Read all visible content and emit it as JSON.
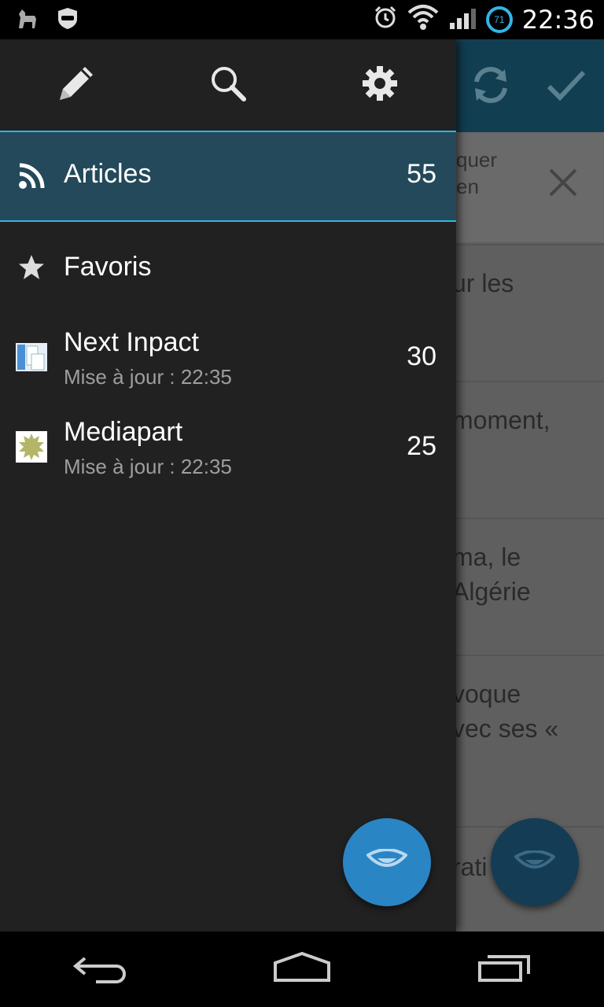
{
  "status_bar": {
    "time": "22:36",
    "battery_level": "71"
  },
  "background": {
    "banner": {
      "line1": "quer",
      "line2": "en"
    },
    "rows": [
      {
        "line1": "ur les",
        "line2": ""
      },
      {
        "line1": "moment,",
        "line2": ""
      },
      {
        "line1": "ma, le",
        "line2": "Algérie"
      },
      {
        "line1": "voque",
        "line2": "vec ses «"
      },
      {
        "line1": "rati",
        "line2": ""
      }
    ]
  },
  "drawer": {
    "header_icons": [
      "pencil-icon",
      "search-icon",
      "settings-icon"
    ],
    "items": [
      {
        "label": "Articles",
        "count": "55",
        "icon": "rss-icon"
      },
      {
        "label": "Favoris",
        "count": "",
        "icon": "star-icon"
      },
      {
        "label": "Next Inpact",
        "count": "30",
        "subtitle": "Mise à jour : 22:35",
        "icon": "nextinpact-favicon"
      },
      {
        "label": "Mediapart",
        "count": "25",
        "subtitle": "Mise à jour : 22:35",
        "icon": "mediapart-favicon"
      }
    ]
  },
  "colors": {
    "accent": "#33b5e5",
    "fab": "#2a85c5",
    "selected_bg": "#23495a",
    "drawer_bg": "#212121"
  }
}
